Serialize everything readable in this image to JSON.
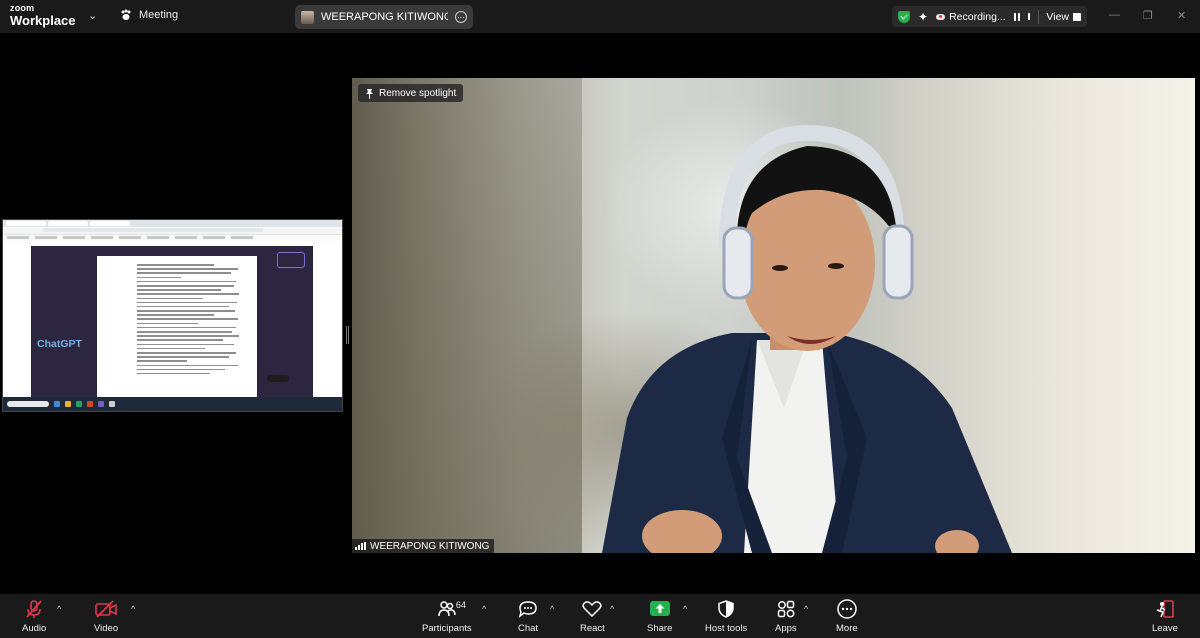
{
  "app": {
    "brand_top": "zoom",
    "brand_bottom": "Workplace",
    "meeting_label": "Meeting",
    "share_pill_text": "WEERAPONG KITIWONG's screer",
    "recording_label": "Recording...",
    "view_label": "View"
  },
  "spotlight": {
    "button_label": "Remove spotlight"
  },
  "video": {
    "participant_name": "WEERAPONG KITIWONG"
  },
  "shared_screen": {
    "chatgpt_label": "ChatGPT"
  },
  "toolbar": {
    "audio": "Audio",
    "video": "Video",
    "participants": "Participants",
    "participants_count": "64",
    "chat": "Chat",
    "react": "React",
    "share": "Share",
    "host_tools": "Host tools",
    "apps": "Apps",
    "more": "More",
    "leave": "Leave"
  },
  "colors": {
    "muted_red": "#e0384b",
    "share_green": "#23b14d",
    "secure_green": "#23b14d",
    "toolbar_bg": "#1a1a1a",
    "titlebar_bg": "#1a1a1a"
  },
  "icons": {
    "audio": "microphone-muted-icon",
    "video": "camera-off-icon",
    "participants": "people-icon",
    "chat": "chat-bubble-icon",
    "react": "heart-icon",
    "share": "share-screen-icon",
    "host_tools": "shield-icon",
    "apps": "apps-icon",
    "more": "more-dots-icon",
    "leave": "leave-door-icon"
  }
}
